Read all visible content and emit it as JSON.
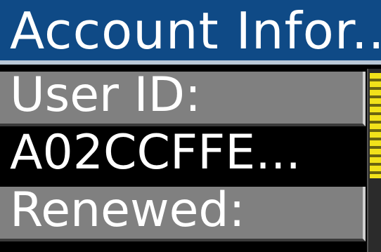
{
  "window": {
    "title": "Account Infor..."
  },
  "list": {
    "rows": [
      {
        "text": "User ID:"
      },
      {
        "text": "A02CCFFE..."
      },
      {
        "text": "Renewed:"
      }
    ]
  },
  "colors": {
    "title_bar": "#0f4a86",
    "label_row": "#808080",
    "background": "#000000",
    "scroll_thumb": "#f2e21a"
  }
}
